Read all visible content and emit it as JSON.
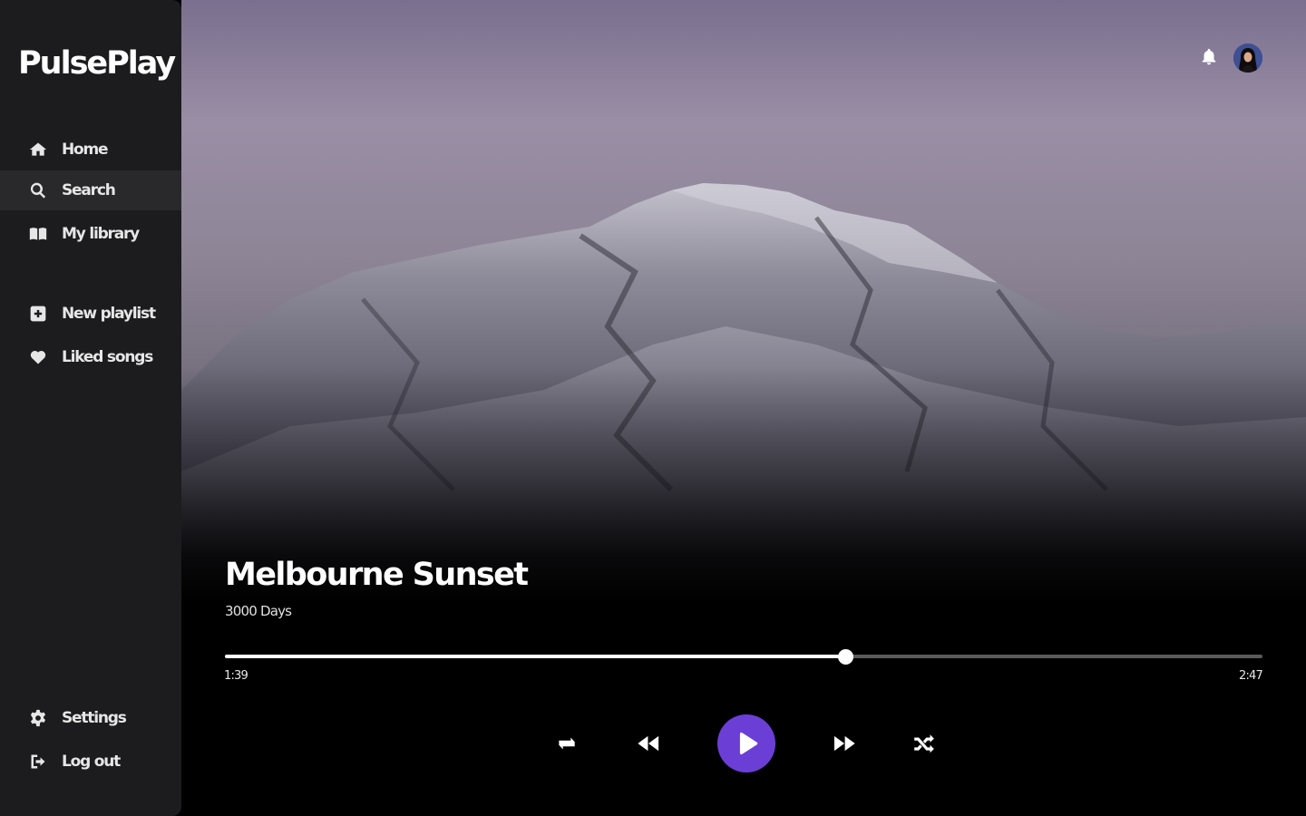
{
  "app": {
    "name": "PulsePlay"
  },
  "sidebar": {
    "items": [
      {
        "label": "Home",
        "icon": "home-icon"
      },
      {
        "label": "Search",
        "icon": "search-icon",
        "active": true
      },
      {
        "label": "My library",
        "icon": "library-icon"
      },
      {
        "label": "New playlist",
        "icon": "plus-square-icon"
      },
      {
        "label": "Liked songs",
        "icon": "heart-icon"
      }
    ],
    "footer": [
      {
        "label": "Settings",
        "icon": "gear-icon"
      },
      {
        "label": "Log out",
        "icon": "logout-icon"
      }
    ]
  },
  "header": {
    "notifications_icon": "bell-icon",
    "avatar_icon": "user-avatar"
  },
  "player": {
    "title": "Melbourne Sunset",
    "artist": "3000 Days",
    "current_time": "1:39",
    "total_time": "2:47",
    "progress": 0.598,
    "controls": [
      "repeat-icon",
      "rewind-icon",
      "play-icon",
      "fast-forward-icon",
      "shuffle-icon"
    ],
    "accent": "#6b3fd6"
  },
  "colors": {
    "sidebar_bg": "#1c1c1e",
    "sidebar_active": "#29292b",
    "background": "#000000"
  }
}
